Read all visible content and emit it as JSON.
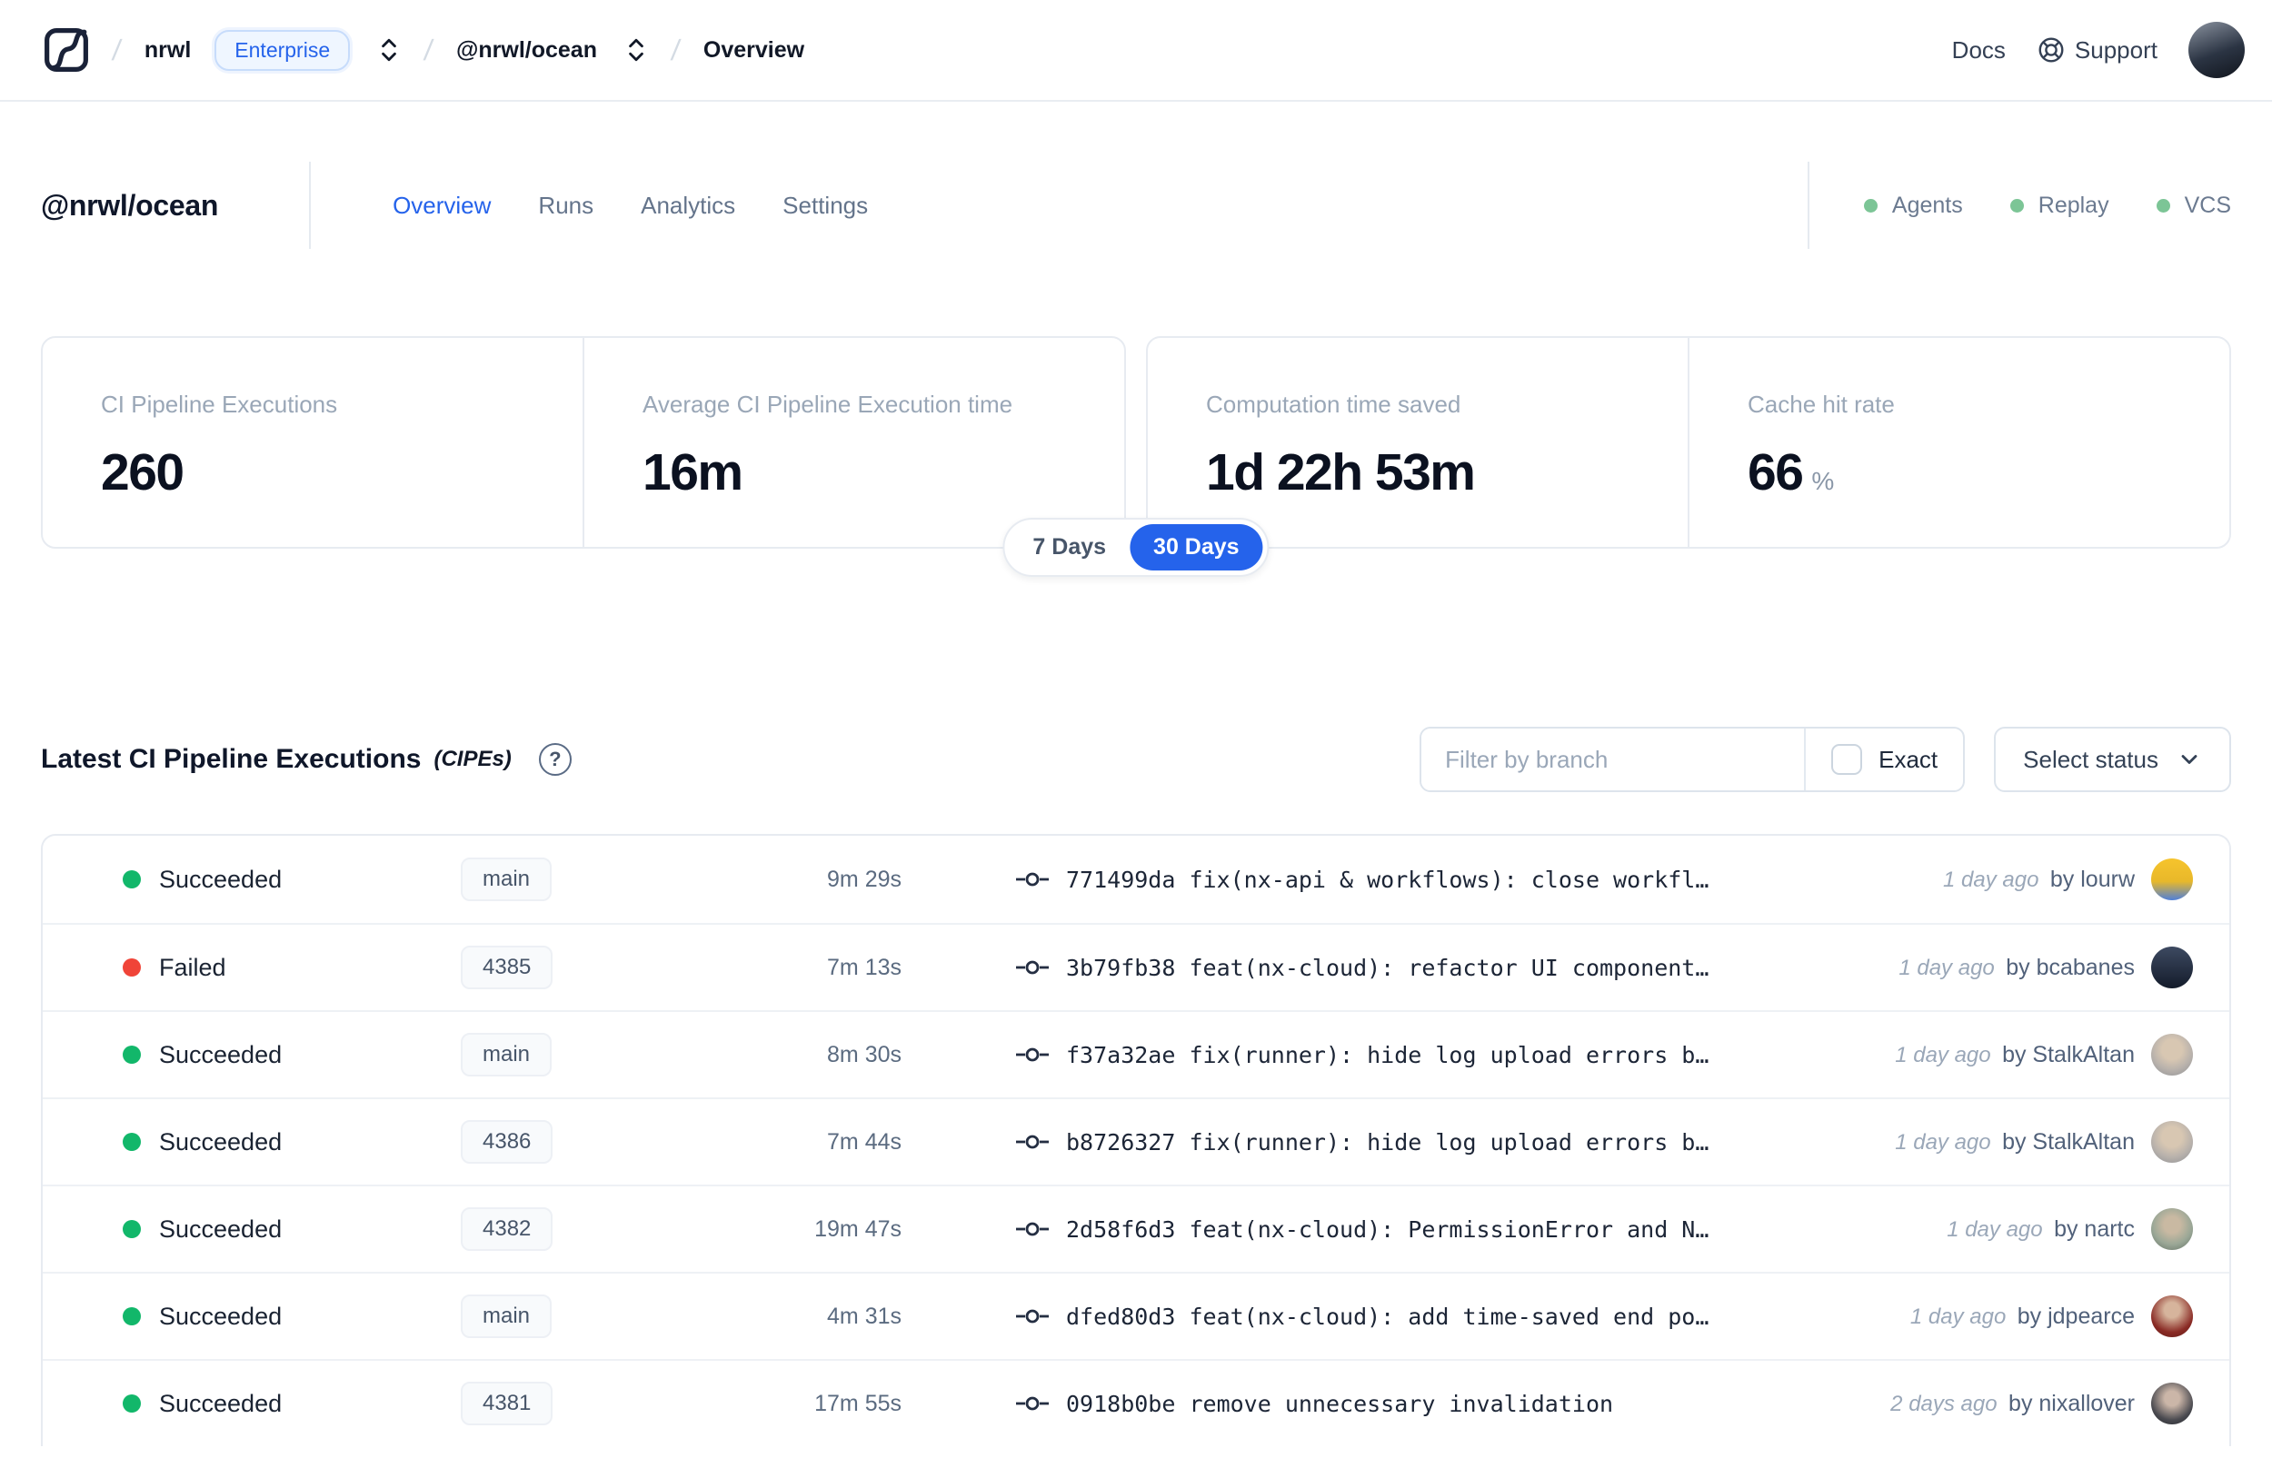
{
  "nav": {
    "separator": "/",
    "org": "nrwl",
    "org_badge": "Enterprise",
    "workspace": "@nrwl/ocean",
    "page": "Overview",
    "docs_label": "Docs",
    "support_label": "Support"
  },
  "workspace": {
    "title": "@nrwl/ocean",
    "tabs": [
      {
        "label": "Overview",
        "active": true
      },
      {
        "label": "Runs",
        "active": false
      },
      {
        "label": "Analytics",
        "active": false
      },
      {
        "label": "Settings",
        "active": false
      }
    ],
    "services": [
      {
        "label": "Agents",
        "status_color": "#7cc596"
      },
      {
        "label": "Replay",
        "status_color": "#7cc596"
      },
      {
        "label": "VCS",
        "status_color": "#7cc596"
      }
    ]
  },
  "stats": {
    "cards": [
      {
        "label": "CI Pipeline Executions",
        "value": "260",
        "suffix": ""
      },
      {
        "label": "Average CI Pipeline Execution time",
        "value": "16m",
        "suffix": ""
      },
      {
        "label": "Computation time saved",
        "value": "1d 22h 53m",
        "suffix": ""
      },
      {
        "label": "Cache hit rate",
        "value": "66",
        "suffix": "%"
      }
    ],
    "range": {
      "options": [
        "7 Days",
        "30 Days"
      ],
      "selected": "30 Days"
    }
  },
  "cipe": {
    "title": "Latest CI Pipeline Executions",
    "subtitle": "(CIPEs)",
    "help_icon": "?",
    "filter_placeholder": "Filter by branch",
    "exact_label": "Exact",
    "select_status_label": "Select status",
    "rows": [
      {
        "status": "Succeeded",
        "status_key": "succeeded",
        "branch": "main",
        "duration": "9m 29s",
        "commit": "771499da fix(nx-api & workflows): close workfl…",
        "time": "1 day ago",
        "author": "by lourw",
        "avatar_key": "lourw"
      },
      {
        "status": "Failed",
        "status_key": "failed",
        "branch": "4385",
        "duration": "7m 13s",
        "commit": "3b79fb38 feat(nx-cloud): refactor UI component…",
        "time": "1 day ago",
        "author": "by bcabanes",
        "avatar_key": "bcabanes"
      },
      {
        "status": "Succeeded",
        "status_key": "succeeded",
        "branch": "main",
        "duration": "8m 30s",
        "commit": "f37a32ae fix(runner): hide log upload errors b…",
        "time": "1 day ago",
        "author": "by StalkAltan",
        "avatar_key": "stalkaltan"
      },
      {
        "status": "Succeeded",
        "status_key": "succeeded",
        "branch": "4386",
        "duration": "7m 44s",
        "commit": "b8726327 fix(runner): hide log upload errors b…",
        "time": "1 day ago",
        "author": "by StalkAltan",
        "avatar_key": "stalkaltan"
      },
      {
        "status": "Succeeded",
        "status_key": "succeeded",
        "branch": "4382",
        "duration": "19m 47s",
        "commit": "2d58f6d3 feat(nx-cloud): PermissionError and N…",
        "time": "1 day ago",
        "author": "by nartc",
        "avatar_key": "nartc"
      },
      {
        "status": "Succeeded",
        "status_key": "succeeded",
        "branch": "main",
        "duration": "4m 31s",
        "commit": "dfed80d3 feat(nx-cloud): add time-saved end po…",
        "time": "1 day ago",
        "author": "by jdpearce",
        "avatar_key": "jdpearce"
      },
      {
        "status": "Succeeded",
        "status_key": "succeeded",
        "branch": "4381",
        "duration": "17m 55s",
        "commit": "0918b0be remove unnecessary invalidation",
        "time": "2 days ago",
        "author": "by nixallover",
        "avatar_key": "nixallover"
      }
    ]
  }
}
